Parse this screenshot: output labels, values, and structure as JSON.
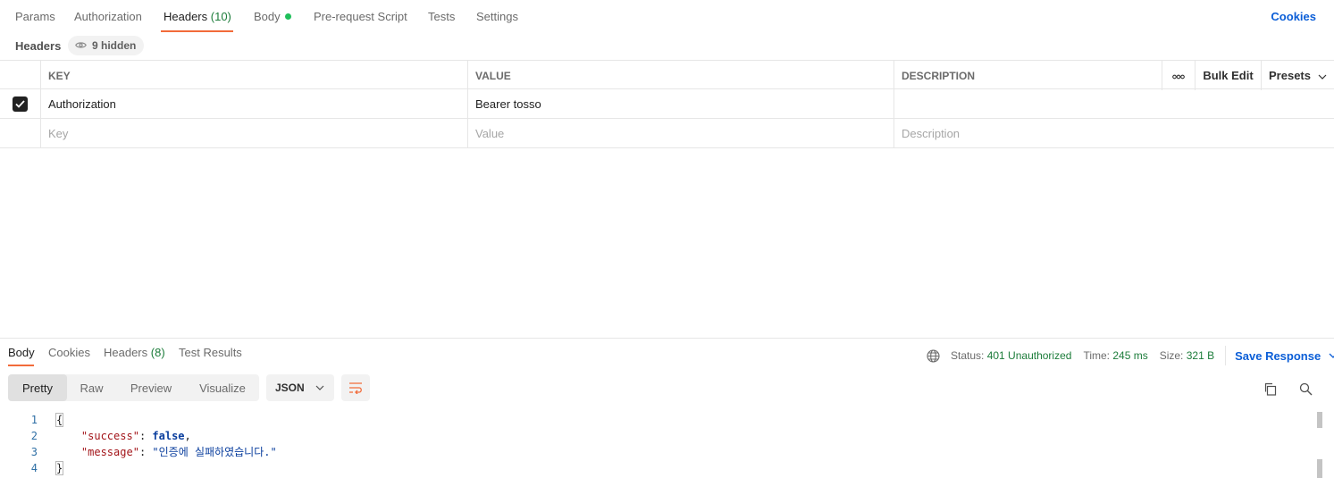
{
  "request_tabs": {
    "params": "Params",
    "authorization": "Authorization",
    "headers": "Headers",
    "headers_count": "(10)",
    "body": "Body",
    "pre_request": "Pre-request Script",
    "tests": "Tests",
    "settings": "Settings",
    "cookies": "Cookies"
  },
  "headers_section": {
    "label": "Headers",
    "hidden_badge": "9 hidden"
  },
  "headers_table": {
    "columns": {
      "key": "KEY",
      "value": "VALUE",
      "description": "DESCRIPTION"
    },
    "tools": {
      "more_icon": "ellipsis-icon",
      "bulk_edit": "Bulk Edit",
      "presets": "Presets"
    },
    "rows": [
      {
        "checked": true,
        "key": "Authorization",
        "value": "Bearer tosso",
        "description": ""
      }
    ],
    "new_row": {
      "key_placeholder": "Key",
      "value_placeholder": "Value",
      "description_placeholder": "Description"
    }
  },
  "response": {
    "tabs": {
      "body": "Body",
      "cookies": "Cookies",
      "headers": "Headers",
      "headers_count": "(8)",
      "test_results": "Test Results"
    },
    "status": {
      "globe_icon": "globe-icon",
      "status_label": "Status:",
      "status_value": "401 Unauthorized",
      "time_label": "Time:",
      "time_value": "245 ms",
      "size_label": "Size:",
      "size_value": "321 B",
      "save_response": "Save Response"
    },
    "format": {
      "pretty": "Pretty",
      "raw": "Raw",
      "preview": "Preview",
      "visualize": "Visualize",
      "language": "JSON"
    },
    "code": {
      "line_numbers": [
        "1",
        "2",
        "3",
        "4"
      ],
      "open_brace": "{",
      "success_key": "\"success\"",
      "success_value": "false",
      "message_key": "\"message\"",
      "message_value": "\"인증에 실패하였습니다.\"",
      "close_brace": "}"
    }
  },
  "colors": {
    "accent_orange": "#f26b3a",
    "link_blue": "#0b5ed7",
    "status_green": "#1c7c3a",
    "body_dot_green": "#1fbf5a"
  }
}
